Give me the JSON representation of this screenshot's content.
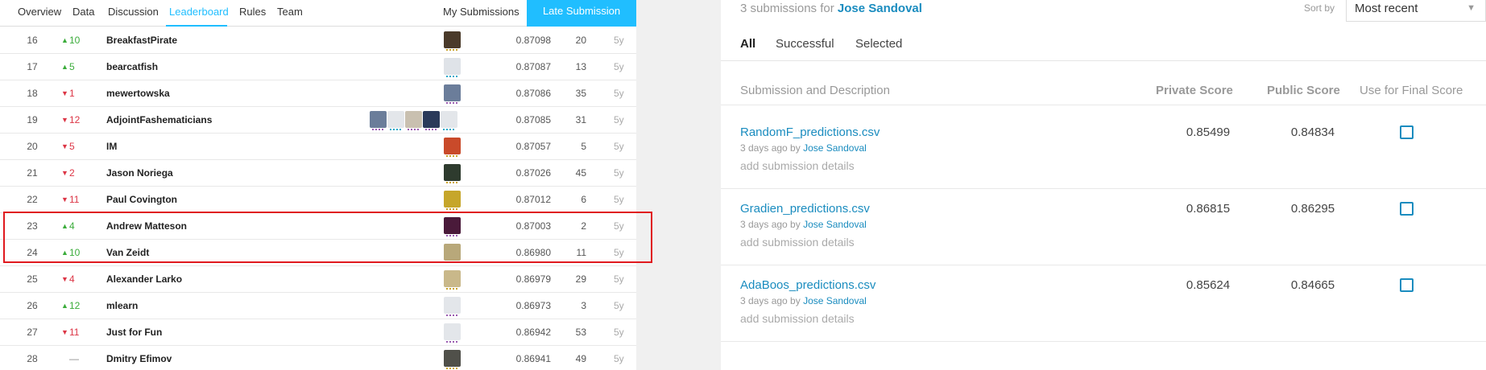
{
  "tabs": [
    "Overview",
    "Data",
    "Discussion",
    "Leaderboard",
    "Rules",
    "Team"
  ],
  "active_tab": "Leaderboard",
  "my_submissions": "My Submissions",
  "late_submission": "Late Submission",
  "leaderboard": [
    {
      "rank": "16",
      "dir": "up",
      "change": "10",
      "name": "BreakfastPirate",
      "score": "0.87098",
      "entries": "20",
      "last": "5y"
    },
    {
      "rank": "17",
      "dir": "up",
      "change": "5",
      "name": "bearcatfish",
      "score": "0.87087",
      "entries": "13",
      "last": "5y"
    },
    {
      "rank": "18",
      "dir": "down",
      "change": "1",
      "name": "mewertowska",
      "score": "0.87086",
      "entries": "35",
      "last": "5y"
    },
    {
      "rank": "19",
      "dir": "down",
      "change": "12",
      "name": "AdjointFashematicians",
      "score": "0.87085",
      "entries": "31",
      "last": "5y"
    },
    {
      "rank": "20",
      "dir": "down",
      "change": "5",
      "name": "IM",
      "score": "0.87057",
      "entries": "5",
      "last": "5y"
    },
    {
      "rank": "21",
      "dir": "down",
      "change": "2",
      "name": "Jason Noriega",
      "score": "0.87026",
      "entries": "45",
      "last": "5y"
    },
    {
      "rank": "22",
      "dir": "down",
      "change": "11",
      "name": "Paul Covington",
      "score": "0.87012",
      "entries": "6",
      "last": "5y"
    },
    {
      "rank": "23",
      "dir": "up",
      "change": "4",
      "name": "Andrew Matteson",
      "score": "0.87003",
      "entries": "2",
      "last": "5y"
    },
    {
      "rank": "24",
      "dir": "up",
      "change": "10",
      "name": "Van Zeidt",
      "score": "0.86980",
      "entries": "11",
      "last": "5y"
    },
    {
      "rank": "25",
      "dir": "down",
      "change": "4",
      "name": "Alexander Larko",
      "score": "0.86979",
      "entries": "29",
      "last": "5y"
    },
    {
      "rank": "26",
      "dir": "up",
      "change": "12",
      "name": "mlearn",
      "score": "0.86973",
      "entries": "3",
      "last": "5y"
    },
    {
      "rank": "27",
      "dir": "down",
      "change": "11",
      "name": "Just for Fun",
      "score": "0.86942",
      "entries": "53",
      "last": "5y"
    },
    {
      "rank": "28",
      "dir": "flat",
      "change": "—",
      "name": "Dmitry Efimov",
      "score": "0.86941",
      "entries": "49",
      "last": "5y"
    }
  ],
  "submissions_panel": {
    "count_text": "3 submissions for",
    "user": "Jose Sandoval",
    "sort_label": "Sort by",
    "sort_value": "Most recent",
    "filters": [
      "All",
      "Successful",
      "Selected"
    ],
    "active_filter": "All",
    "col_desc": "Submission and Description",
    "col_private": "Private Score",
    "col_public": "Public Score",
    "col_final": "Use for Final Score",
    "items": [
      {
        "file": "RandomF_predictions.csv",
        "meta": "3 days ago by",
        "by": "Jose Sandoval",
        "details": "add submission details",
        "private": "0.85499",
        "public": "0.84834"
      },
      {
        "file": "Gradien_predictions.csv",
        "meta": "3 days ago by",
        "by": "Jose Sandoval",
        "details": "add submission details",
        "private": "0.86815",
        "public": "0.86295"
      },
      {
        "file": "AdaBoos_predictions.csv",
        "meta": "3 days ago by",
        "by": "Jose Sandoval",
        "details": "add submission details",
        "private": "0.85624",
        "public": "0.84665"
      }
    ]
  }
}
